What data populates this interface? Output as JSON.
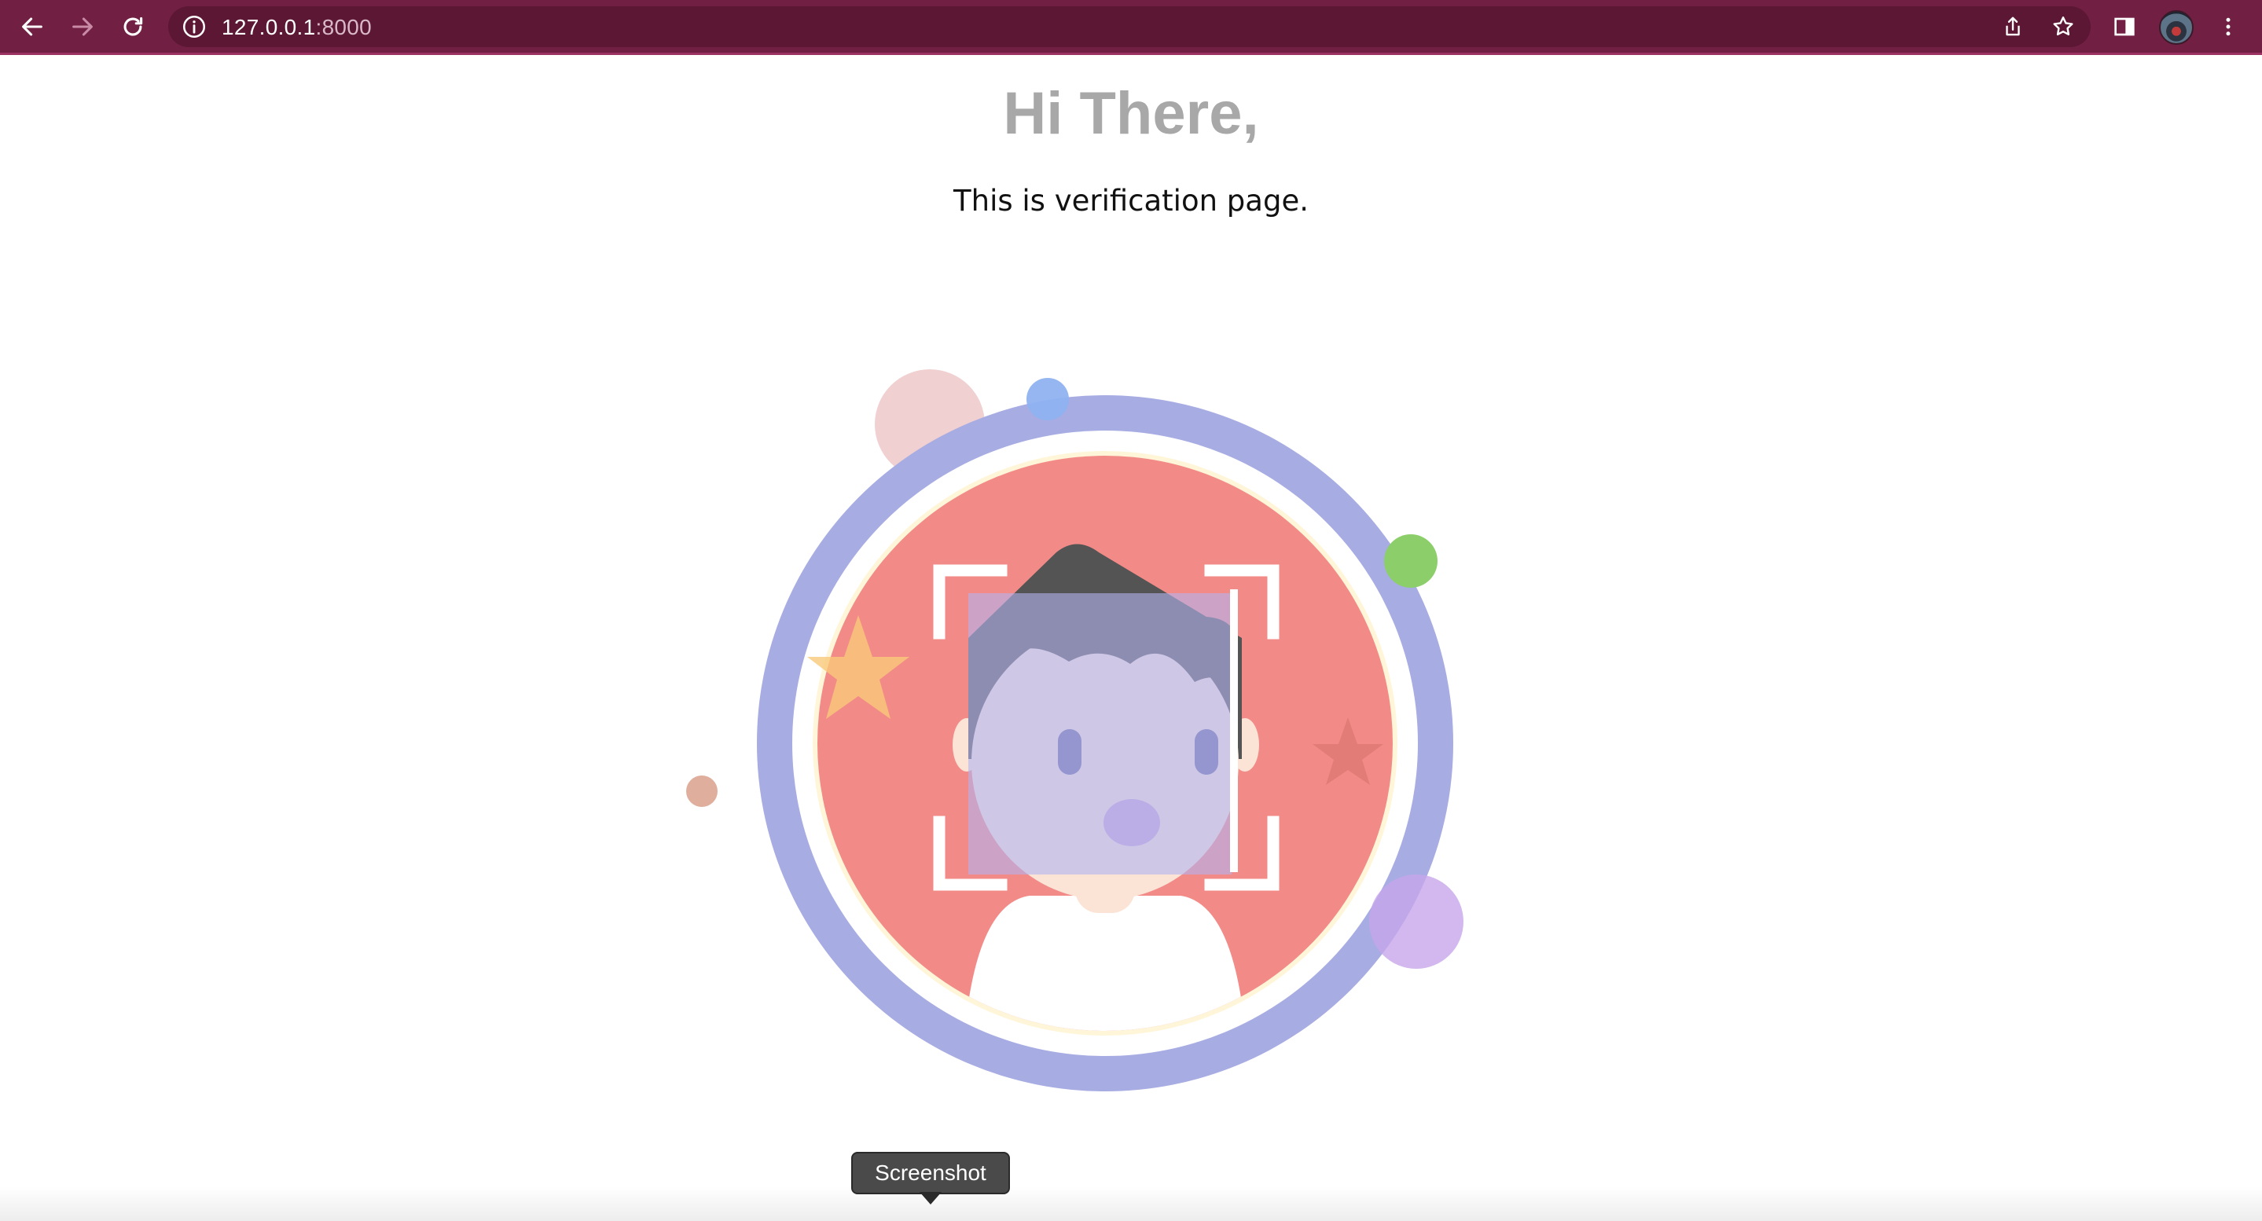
{
  "browser": {
    "url_host": "127.0.0.1",
    "url_port": ":8000",
    "icons": {
      "back": "arrow-left-icon",
      "forward": "arrow-right-icon",
      "reload": "reload-icon",
      "site_info": "info-icon",
      "share": "share-icon",
      "bookmark": "star-icon",
      "side_panel": "side-panel-icon",
      "profile": "avatar",
      "menu": "kebab-menu-icon"
    },
    "colors": {
      "toolbar": "#721f44",
      "omnibox": "#5b1734"
    }
  },
  "page": {
    "greeting": "Hi There,",
    "subtitle": "This is verification page.",
    "illustration": "face-verification-illustration"
  },
  "tooltip": {
    "label": "Screenshot"
  }
}
